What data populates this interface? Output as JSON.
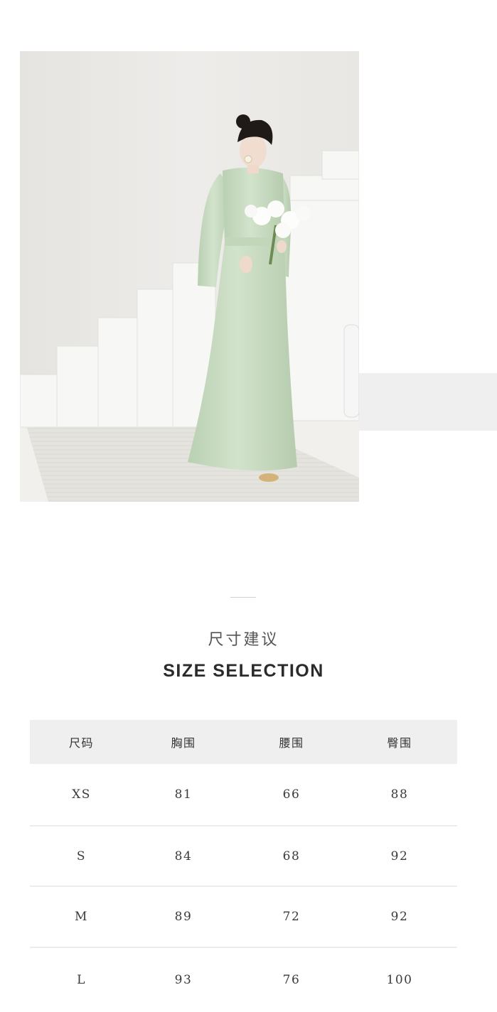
{
  "product_photo": {
    "alt": "mint green satin long-sleeve dress, model holding white orchid bouquet beside white staircase"
  },
  "title": {
    "cn": "尺寸建议",
    "en": "SIZE SELECTION"
  },
  "size_table": {
    "headers": [
      "尺码",
      "胸围",
      "腰围",
      "臀围"
    ],
    "rows": [
      [
        "XS",
        "81",
        "66",
        "88"
      ],
      [
        "S",
        "84",
        "68",
        "92"
      ],
      [
        "M",
        "89",
        "72",
        "92"
      ],
      [
        "L",
        "93",
        "76",
        "100"
      ]
    ]
  },
  "colors": {
    "dress": "#c8dcc0",
    "table_header_bg": "#efefef",
    "text": "#333333"
  }
}
